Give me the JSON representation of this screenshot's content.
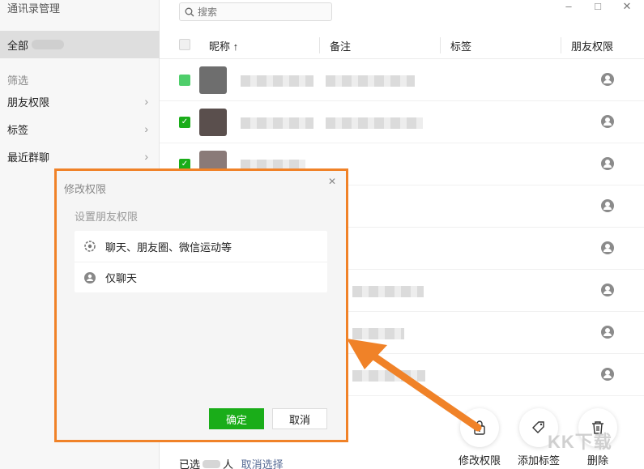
{
  "sidebar": {
    "title": "通讯录管理",
    "all_label": "全部",
    "section_label": "筛选",
    "items": [
      {
        "label": "朋友权限"
      },
      {
        "label": "标签"
      },
      {
        "label": "最近群聊"
      }
    ]
  },
  "search": {
    "placeholder": "搜索"
  },
  "window": {
    "minimize": "–",
    "maximize": "□",
    "close": "✕"
  },
  "table": {
    "columns": [
      "昵称 ↑",
      "备注",
      "标签",
      "朋友权限"
    ],
    "rows": [
      {
        "checked": "partial"
      },
      {
        "checked": true
      },
      {
        "checked": true
      },
      {
        "checked": false
      },
      {
        "checked": false
      },
      {
        "checked": false
      },
      {
        "checked": false
      },
      {
        "checked": false
      }
    ]
  },
  "footer": {
    "selected_prefix": "已选",
    "selected_suffix": "人",
    "cancel_selection": "取消选择"
  },
  "actions": [
    {
      "label": "修改权限",
      "icon": "lock-icon"
    },
    {
      "label": "添加标签",
      "icon": "tag-icon"
    },
    {
      "label": "删除",
      "icon": "trash-icon"
    }
  ],
  "modal": {
    "title": "修改权限",
    "close": "✕",
    "subtitle": "设置朋友权限",
    "options": [
      {
        "label": "聊天、朋友圈、微信运动等",
        "icon": "moments-icon"
      },
      {
        "label": "仅聊天",
        "icon": "chat-only-icon"
      }
    ],
    "confirm": "确定",
    "cancel": "取消"
  },
  "watermark": "KK下载",
  "colors": {
    "accent": "#1aad19",
    "highlight": "#f08228",
    "link": "#576b95"
  }
}
